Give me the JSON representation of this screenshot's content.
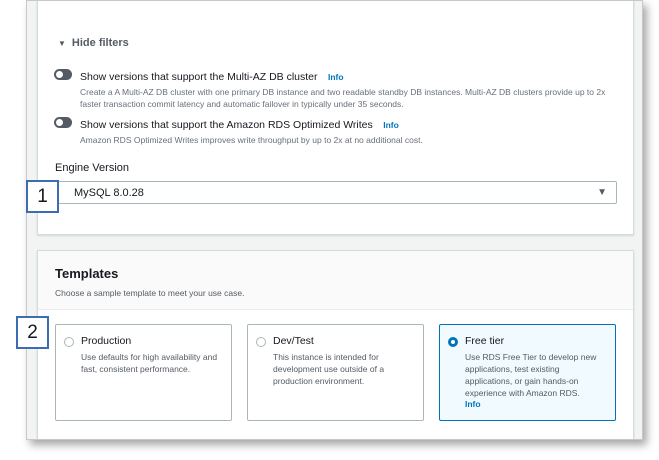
{
  "filters": {
    "toggle_label": "Hide filters",
    "items": [
      {
        "title": "Show versions that support the Multi-AZ DB cluster",
        "info": "Info",
        "description": "Create a A Multi-AZ DB cluster with one primary DB instance and two readable standby DB instances. Multi-AZ DB clusters provide up to 2x faster transaction commit latency and automatic failover in typically under 35 seconds.",
        "enabled": false
      },
      {
        "title": "Show versions that support the Amazon RDS Optimized Writes",
        "info": "Info",
        "description": "Amazon RDS Optimized Writes improves write throughput by up to 2x at no additional cost.",
        "enabled": false
      }
    ]
  },
  "engine_version": {
    "label": "Engine Version",
    "value": "MySQL 8.0.28"
  },
  "templates": {
    "title": "Templates",
    "description": "Choose a sample template to meet your use case.",
    "options": [
      {
        "title": "Production",
        "description": "Use defaults for high availability and fast, consistent performance.",
        "info": "",
        "selected": false
      },
      {
        "title": "Dev/Test",
        "description": "This instance is intended for development use outside of a production environment.",
        "info": "",
        "selected": false
      },
      {
        "title": "Free tier",
        "description": "Use RDS Free Tier to develop new applications, test existing applications, or gain hands-on experience with Amazon RDS.",
        "info": "Info",
        "selected": true
      }
    ]
  },
  "callouts": [
    "1",
    "2"
  ],
  "colors": {
    "accent": "#0073bb",
    "toggle_off": "#545b64",
    "callout_border": "#3c6cb4"
  },
  "icons": {
    "filters_caret": "caret-down-icon",
    "select_arrow": "dropdown-arrow-icon"
  }
}
